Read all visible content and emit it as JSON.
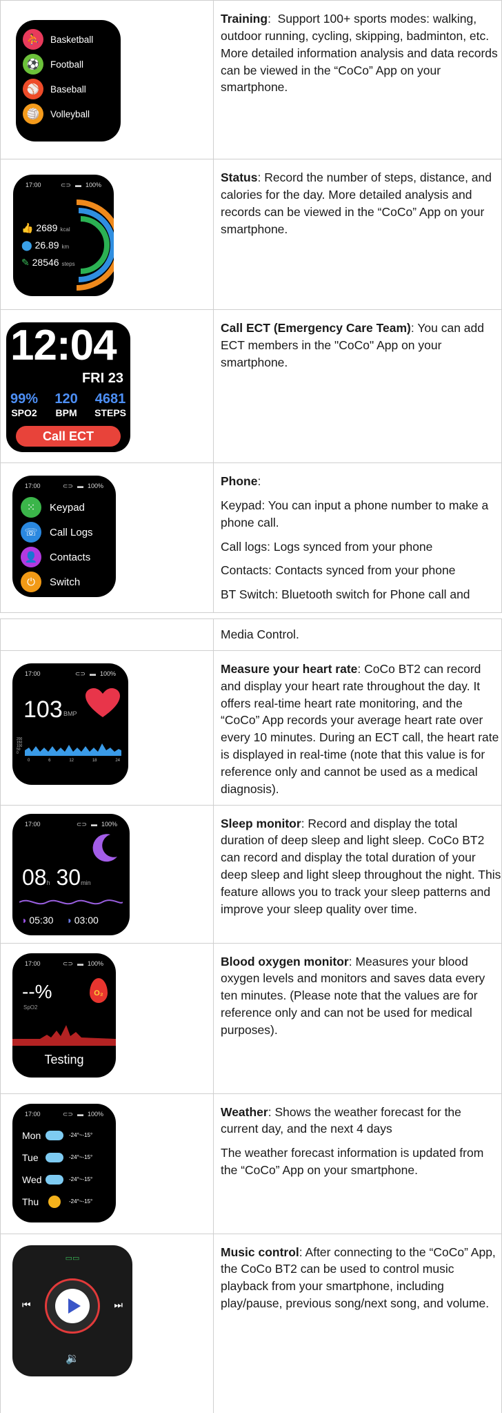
{
  "rows": [
    {
      "id": "training",
      "title": "Training",
      "paragraphs": [
        "Support 100+ sports modes: walking, outdoor running, cycling, skipping, badminton, etc. More detailed information analysis and data records can be viewed in the “CoCo” App on your smartphone."
      ],
      "watch": {
        "items": [
          "Basketball",
          "Football",
          "Baseball",
          "Volleyball"
        ],
        "colors": [
          "#e83a5b",
          "#6cc13a",
          "#ee4c2a",
          "#f49b1c"
        ]
      }
    },
    {
      "id": "status",
      "title": "Status",
      "paragraphs": [
        "Record the number of steps, distance, and calories for the day. More detailed analysis and records can be viewed in the “CoCo” App on your smartphone."
      ],
      "watch": {
        "time": "17:00",
        "battery": "100%",
        "stats": [
          {
            "value": "2689",
            "unit": "kcal",
            "icon_color": "#f1a12b"
          },
          {
            "value": "26.89",
            "unit": "km",
            "icon_color": "#39a0e8"
          },
          {
            "value": "28546",
            "unit": "steps",
            "icon_color": "#3bbf5a"
          }
        ],
        "ring_colors": [
          "#f08a1c",
          "#2f8ee0",
          "#2bb153"
        ]
      }
    },
    {
      "id": "call-ect",
      "title": "Call ECT (Emergency Care Team)",
      "paragraphs": [
        "You can add ECT members in the \"CoCo\" App on your smartphone."
      ],
      "watch": {
        "clock": "12:04",
        "date": "FRI 23",
        "metrics": [
          {
            "value": "99%",
            "label": "SPO2"
          },
          {
            "value": "120",
            "label": "BPM"
          },
          {
            "value": "4681",
            "label": "STEPS"
          }
        ],
        "button": "Call ECT"
      }
    },
    {
      "id": "phone",
      "title": "Phone",
      "paragraphs": [
        "Keypad: You can input a phone number to make a phone call.",
        "Call logs: Logs synced from your phone",
        "Contacts: Contacts synced from your phone",
        "BT Switch: Bluetooth switch for Phone call and"
      ],
      "watch": {
        "time": "17:00",
        "battery": "100%",
        "items": [
          "Keypad",
          "Call Logs",
          "Contacts",
          "Switch"
        ],
        "colors": [
          "#3bb54a",
          "#2a88e0",
          "#b23ae0",
          "#f29a16"
        ]
      }
    },
    {
      "id": "media-control-cont",
      "paragraphs": [
        "Media Control."
      ]
    },
    {
      "id": "heart-rate",
      "title": "Measure your heart rate",
      "paragraphs": [
        "CoCo BT2 can record and display your heart rate throughout the day. It offers real-time heart rate monitoring, and the “CoCo” App records your average heart rate over every 10 minutes. During an ECT call, the heart rate is displayed in real-time (note that this value is for reference only and cannot be used as a medical diagnosis)."
      ],
      "watch": {
        "time": "17:00",
        "battery": "100%",
        "value": "103",
        "unit": "BMP",
        "ticks": [
          "0",
          "6",
          "12",
          "18",
          "24"
        ],
        "y_ticks": [
          "200",
          "150",
          "100",
          "50",
          "0"
        ]
      }
    },
    {
      "id": "sleep",
      "title": "Sleep monitor",
      "paragraphs": [
        "Record and display the total duration of deep sleep and light sleep. CoCo BT2 can record and display the total duration of your deep sleep and light sleep throughout the night. This feature allows you to track your sleep patterns and improve your sleep quality over time."
      ],
      "watch": {
        "time": "17:00",
        "battery": "100%",
        "hours": "08",
        "h_unit": "h",
        "minutes": "30",
        "m_unit": "min",
        "deep": "05:30",
        "light": "03:00"
      }
    },
    {
      "id": "blood-oxygen",
      "title": "Blood oxygen monitor",
      "paragraphs": [
        "Measures your blood oxygen levels and monitors and saves data every ten minutes. (Please note that the values are for reference only and can not be used for medical purposes)."
      ],
      "watch": {
        "time": "17:00",
        "battery": "100%",
        "value": "--%",
        "label": "SpO2",
        "drop_text": "O₂",
        "status": "Testing"
      }
    },
    {
      "id": "weather",
      "title": "Weather",
      "paragraphs": [
        "Shows the weather forecast for the current day, and the next 4 days",
        "The weather forecast information is updated from the “CoCo” App on your smartphone."
      ],
      "watch": {
        "time": "17:00",
        "battery": "100%",
        "days": [
          {
            "day": "Mon",
            "icon": "cloud-icon",
            "range": "-24°~-15°"
          },
          {
            "day": "Tue",
            "icon": "cloud-icon",
            "range": "-24°~-15°"
          },
          {
            "day": "Wed",
            "icon": "cloud-icon",
            "range": "-24°~-15°"
          },
          {
            "day": "Thu",
            "icon": "sun-icon",
            "range": "-24°~-15°"
          }
        ]
      }
    },
    {
      "id": "music",
      "title": "Music control",
      "paragraphs": [
        "After connecting to the “CoCo” App, the CoCo BT2 can be used to control music playback from your smartphone, including play/pause, previous song/next song, and volume."
      ],
      "watch": {
        "top_icon": "watch-link-icon"
      }
    }
  ]
}
